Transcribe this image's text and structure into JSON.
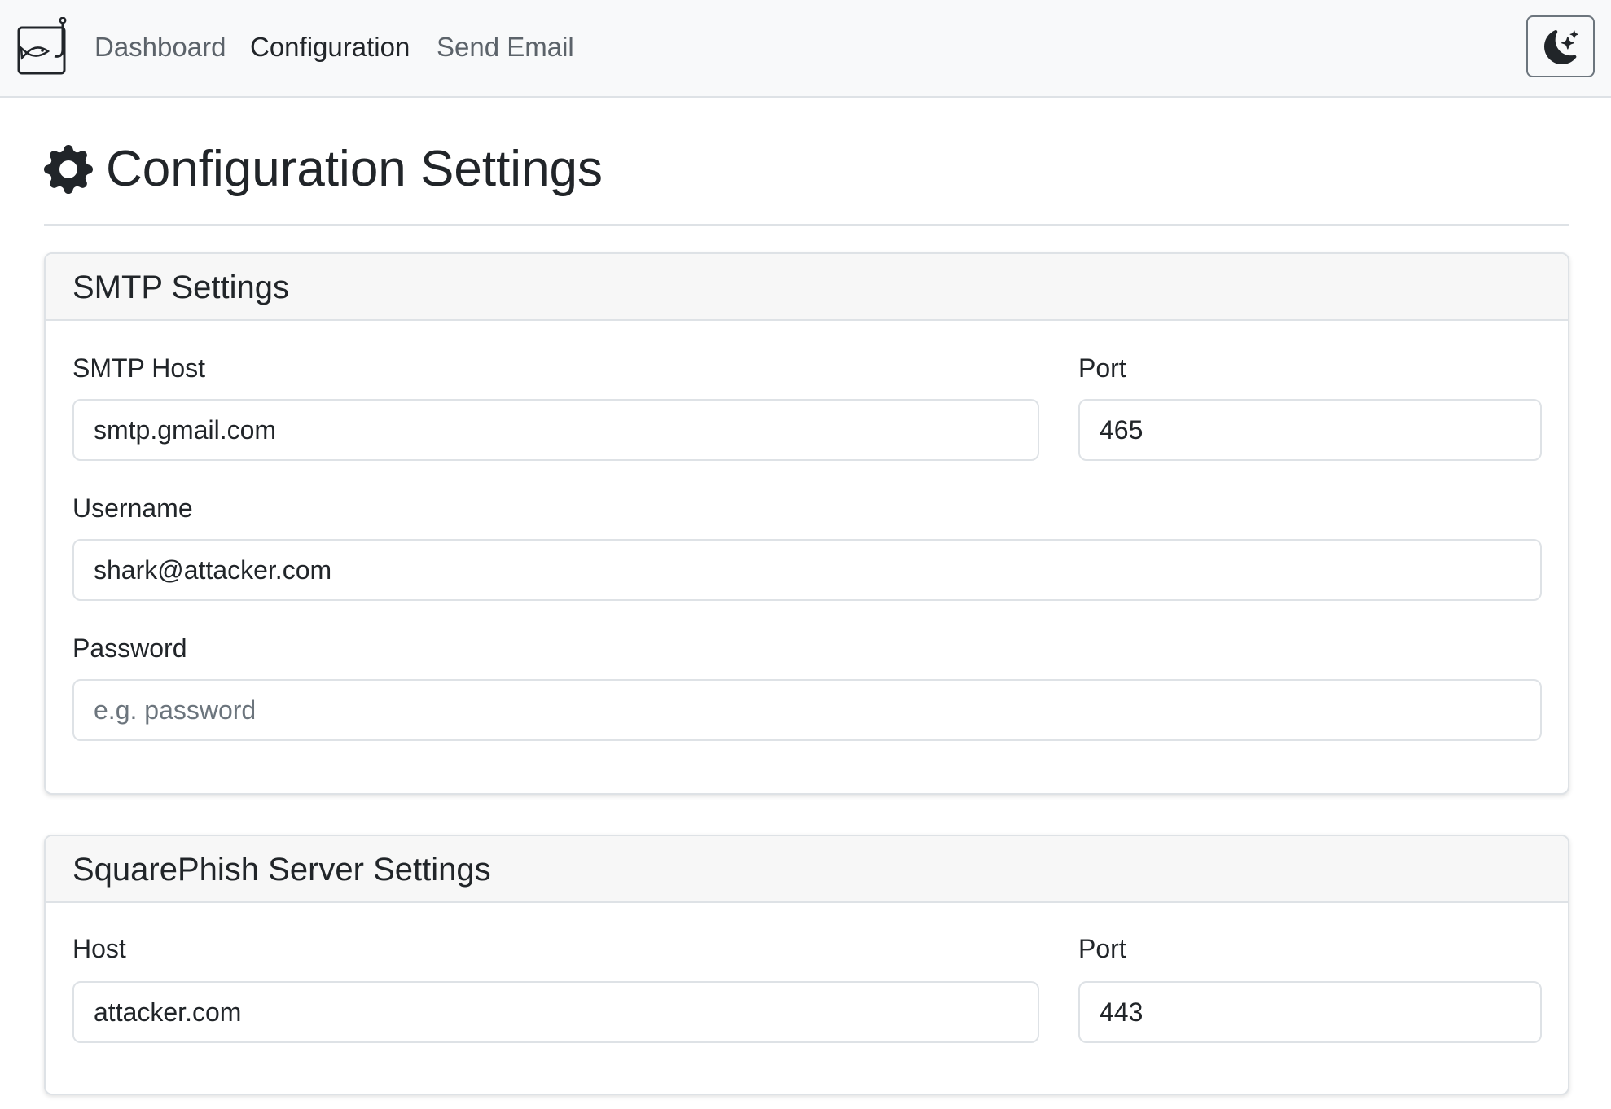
{
  "navbar": {
    "links": [
      {
        "label": "Dashboard",
        "active": false
      },
      {
        "label": "Configuration",
        "active": true
      },
      {
        "label": "Send Email",
        "active": false
      }
    ],
    "theme_toggle_icon": "moon-stars-icon",
    "brand_icon": "fish-hook-logo-icon"
  },
  "page": {
    "title": "Configuration Settings",
    "title_icon": "gear-icon"
  },
  "smtp": {
    "title": "SMTP Settings",
    "host_label": "SMTP Host",
    "host_value": "smtp.gmail.com",
    "port_label": "Port",
    "port_value": "465",
    "username_label": "Username",
    "username_value": "shark@attacker.com",
    "password_label": "Password",
    "password_value": "",
    "password_placeholder": "e.g. password"
  },
  "squarephish": {
    "title": "SquarePhish Server Settings",
    "host_label": "Host",
    "host_value": "attacker.com",
    "port_label": "Port",
    "port_value": "443"
  },
  "colors": {
    "navbar_bg": "#f8f9fa",
    "text": "#212529",
    "muted_link": "#5c636a",
    "border": "#dee2e6"
  }
}
